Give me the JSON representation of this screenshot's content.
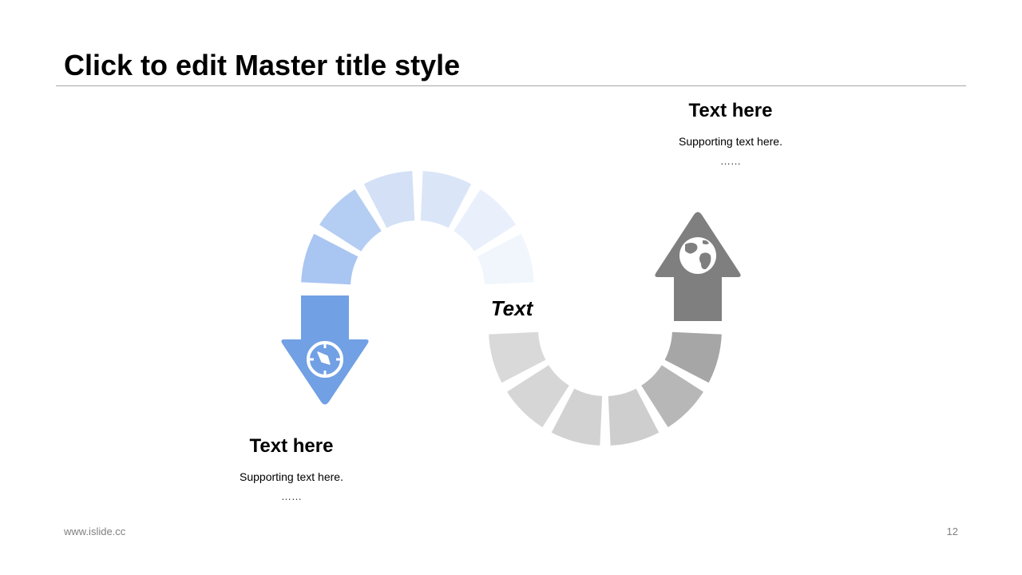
{
  "slide": {
    "title": "Click to edit Master title style",
    "footer_url": "www.islide.cc",
    "page_number": "12"
  },
  "diagram": {
    "center_label": "Text",
    "blocks": [
      {
        "heading": "Text here",
        "supporting": "Supporting text here.",
        "ellipsis": "……",
        "icon": "compass-icon"
      },
      {
        "heading": "Text here",
        "supporting": "Supporting text here.",
        "ellipsis": "……",
        "icon": "globe-icon"
      }
    ],
    "colors": {
      "blue_arrow": "#71a0e4",
      "gray_arrow": "#7f7f7f",
      "upper_arc": [
        "#a9c5f1",
        "#b4cdf2",
        "#d3e0f6",
        "#dae6f8",
        "#e9f0fb",
        "#f1f6fd"
      ],
      "lower_arc": [
        "#d9d9d9",
        "#d6d6d6",
        "#d2d2d2",
        "#cecece",
        "#b7b7b7",
        "#a6a6a6"
      ]
    }
  }
}
